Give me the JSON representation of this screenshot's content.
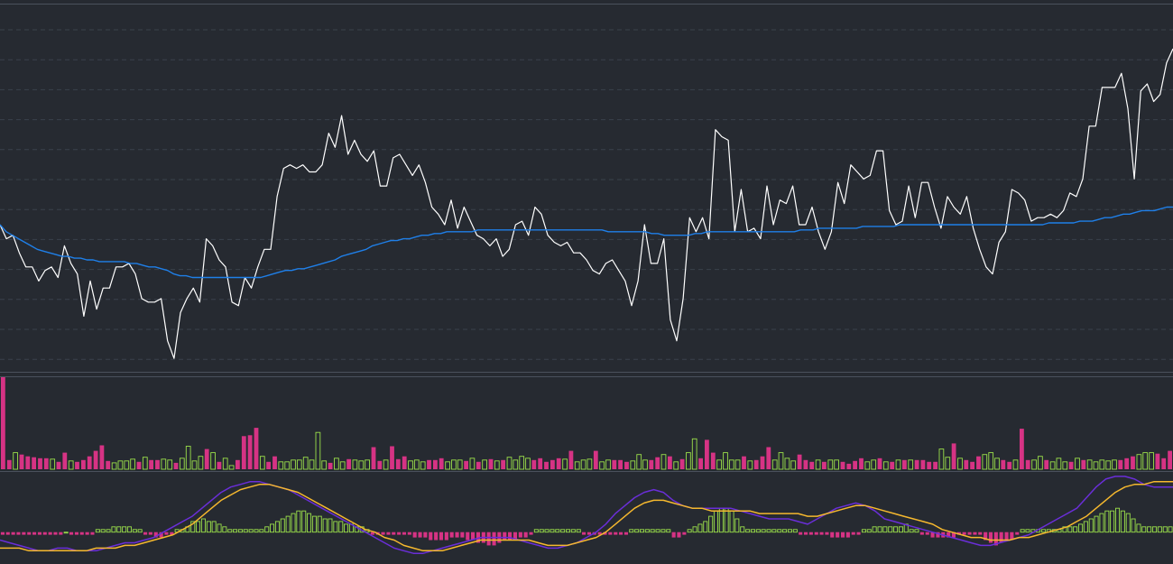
{
  "colors": {
    "background": "#262a31",
    "grid": "#3a414c",
    "separator": "#4a515c",
    "price_line": "#ffffff",
    "moving_average": "#1f7fe8",
    "volume_down": "#d63384",
    "volume_up": "#9be04a",
    "macd_line": "#6a2ed8",
    "signal_line": "#f5b82e"
  },
  "chart_data": [
    {
      "type": "line",
      "panel": "price",
      "grid": true,
      "xlabel": "",
      "ylabel": "",
      "ylim": [
        0,
        100
      ],
      "series": [
        {
          "role": "price",
          "values": [
            40,
            36,
            37,
            32,
            28,
            28,
            24,
            27,
            28,
            25,
            34,
            29,
            26,
            14,
            24,
            16,
            22,
            22,
            28,
            28,
            29,
            26,
            19,
            18,
            18,
            19,
            7,
            2,
            15,
            19,
            22,
            18,
            36,
            34,
            30,
            28,
            18,
            17,
            25,
            22,
            28,
            33,
            33,
            48,
            56,
            57,
            56,
            57,
            55,
            55,
            57,
            66,
            62,
            71,
            60,
            64,
            60,
            58,
            61,
            51,
            51,
            59,
            60,
            57,
            54,
            57,
            52,
            45,
            43,
            40,
            47,
            39,
            45,
            41,
            37,
            36,
            34,
            36,
            31,
            33,
            40,
            41,
            37,
            45,
            43,
            37,
            35,
            34,
            35,
            32,
            32,
            30,
            27,
            26,
            29,
            30,
            27,
            24,
            17,
            24,
            40,
            29,
            29,
            36,
            13,
            7,
            19,
            42,
            38,
            42,
            36,
            67,
            65,
            64,
            38,
            50,
            38,
            39,
            36,
            51,
            40,
            47,
            46,
            51,
            40,
            40,
            45,
            38,
            33,
            38,
            52,
            46,
            57,
            55,
            53,
            54,
            61,
            61,
            44,
            40,
            41,
            51,
            42,
            52,
            52,
            45,
            39,
            48,
            45,
            43,
            48,
            39,
            33,
            28,
            26,
            35,
            38,
            50,
            49,
            47,
            41,
            42,
            42,
            43,
            42,
            44,
            49,
            48,
            53,
            68,
            68,
            79,
            79,
            79,
            83,
            73,
            53,
            78,
            80,
            75,
            77,
            86,
            90
          ]
        },
        {
          "role": "moving_average",
          "values": [
            40,
            38,
            37,
            36,
            35,
            34,
            33,
            32.5,
            32,
            31.5,
            31,
            31,
            30.5,
            30.5,
            30,
            30,
            29.5,
            29.5,
            29.5,
            29.5,
            29.5,
            29,
            29,
            28.5,
            28,
            28,
            27.5,
            27,
            26,
            25.5,
            25.5,
            25,
            25,
            25,
            25,
            25,
            25,
            25,
            25,
            25,
            25,
            25,
            25,
            25.5,
            26,
            26.5,
            27,
            27,
            27.5,
            27.5,
            28,
            28.5,
            29,
            29.5,
            30,
            31,
            31.5,
            32,
            32.5,
            33,
            34,
            34.5,
            35,
            35.5,
            35.5,
            36,
            36,
            36.5,
            37,
            37,
            37.5,
            37.5,
            38,
            38,
            38,
            38,
            38,
            38.5,
            38.5,
            38.5,
            38.5,
            38.5,
            38.5,
            38.5,
            38.5,
            38.5,
            38.5,
            38.5,
            38.5,
            38.5,
            38.5,
            38.5,
            38.5,
            38.5,
            38.5,
            38.5,
            38.5,
            38.5,
            38,
            38,
            38,
            38,
            38,
            38,
            38,
            37.5,
            37.5,
            37,
            37,
            37,
            37,
            37,
            37.5,
            37.5,
            38,
            38,
            38,
            38,
            38,
            38,
            38,
            38,
            38,
            38,
            38,
            38,
            38,
            38,
            38,
            38.5,
            38.5,
            38.5,
            39,
            39,
            39,
            39,
            39,
            39,
            39,
            39.5,
            39.5,
            39.5,
            39.5,
            39.5,
            39.5,
            40,
            40,
            40,
            40,
            40,
            40,
            40,
            40,
            40,
            40,
            40,
            40,
            40,
            40,
            40,
            40,
            40,
            40,
            40,
            40,
            40,
            40,
            40,
            40,
            40.5,
            40.5,
            40.5,
            40.5,
            40.5,
            41,
            41,
            41,
            41.5,
            42,
            42,
            42.5,
            43,
            43,
            43.5,
            44,
            44,
            44,
            44.5,
            45,
            45
          ]
        }
      ]
    },
    {
      "type": "bar",
      "panel": "volume",
      "ylim": [
        0,
        100
      ],
      "values": [
        100,
        10,
        18,
        16,
        14,
        13,
        12,
        12,
        11,
        8,
        18,
        9,
        8,
        10,
        14,
        20,
        26,
        9,
        7,
        9,
        9,
        11,
        8,
        13,
        10,
        10,
        11,
        10,
        7,
        12,
        25,
        9,
        14,
        22,
        18,
        8,
        12,
        4,
        10,
        36,
        37,
        45,
        14,
        8,
        14,
        8,
        8,
        10,
        10,
        13,
        10,
        40,
        9,
        7,
        12,
        8,
        11,
        10,
        9,
        10,
        24,
        9,
        10,
        25,
        11,
        14,
        9,
        10,
        8,
        10,
        10,
        12,
        8,
        10,
        10,
        9,
        12,
        8,
        10,
        11,
        9,
        10,
        13,
        10,
        14,
        12,
        10,
        12,
        8,
        10,
        12,
        11,
        20,
        8,
        10,
        11,
        20,
        8,
        10,
        10,
        10,
        8,
        9,
        16,
        10,
        10,
        13,
        16,
        14,
        8,
        11,
        18,
        33,
        12,
        32,
        18,
        10,
        18,
        10,
        10,
        14,
        9,
        10,
        14,
        24,
        10,
        18,
        12,
        9,
        16,
        10,
        8,
        10,
        8,
        10,
        10,
        8,
        6,
        9,
        12,
        8,
        10,
        12,
        8,
        8,
        10,
        10,
        10,
        10,
        10,
        8,
        8,
        22,
        13,
        28,
        12,
        10,
        8,
        14,
        16,
        18,
        12,
        10,
        8,
        10,
        44,
        10,
        10,
        14,
        10,
        8,
        12,
        8,
        8,
        12,
        10,
        10,
        8,
        10,
        9,
        10,
        10,
        12,
        14,
        16,
        18,
        18,
        17,
        12,
        20
      ],
      "direction": [
        "down",
        "down",
        "up",
        "down",
        "down",
        "down",
        "down",
        "down",
        "up",
        "down",
        "down",
        "up",
        "down",
        "down",
        "down",
        "down",
        "down",
        "down",
        "up",
        "up",
        "up",
        "up",
        "down",
        "up",
        "down",
        "down",
        "up",
        "up",
        "down",
        "up",
        "up",
        "up",
        "up",
        "down",
        "up",
        "down",
        "up",
        "up",
        "down",
        "down",
        "down",
        "down",
        "up",
        "down",
        "down",
        "up",
        "up",
        "up",
        "up",
        "up",
        "up",
        "up",
        "up",
        "down",
        "up",
        "up",
        "down",
        "up",
        "up",
        "up",
        "down",
        "down",
        "up",
        "down",
        "down",
        "down",
        "up",
        "up",
        "up",
        "down",
        "down",
        "down",
        "up",
        "up",
        "up",
        "down",
        "up",
        "down",
        "up",
        "down",
        "up",
        "down",
        "up",
        "up",
        "up",
        "up",
        "down",
        "down",
        "down",
        "down",
        "down",
        "up",
        "down",
        "up",
        "up",
        "up",
        "down",
        "up",
        "up",
        "down",
        "down",
        "down",
        "up",
        "up",
        "up",
        "down",
        "down",
        "up",
        "down",
        "up",
        "down",
        "up",
        "up",
        "down",
        "down",
        "down",
        "up",
        "up",
        "up",
        "up",
        "down",
        "up",
        "down",
        "down",
        "down",
        "up",
        "up",
        "up",
        "up",
        "down",
        "down",
        "down",
        "up",
        "down",
        "up",
        "up",
        "down",
        "down",
        "down",
        "down",
        "up",
        "up",
        "down",
        "up",
        "down",
        "up",
        "down",
        "up",
        "down",
        "down",
        "down",
        "down",
        "up",
        "up",
        "down",
        "up",
        "down",
        "down",
        "down",
        "up",
        "up",
        "up",
        "down",
        "down",
        "up",
        "down",
        "down",
        "up",
        "up",
        "down",
        "up",
        "up",
        "up",
        "down",
        "up",
        "down",
        "up",
        "up",
        "up",
        "up",
        "up",
        "down",
        "down",
        "down",
        "up",
        "up",
        "up"
      ]
    },
    {
      "type": "bar",
      "panel": "macd",
      "ylim": [
        -12,
        22
      ],
      "series": [
        {
          "role": "histogram",
          "values": [
            -1,
            -1,
            -1,
            -1,
            -1,
            -1,
            -1,
            -1,
            -1,
            -1,
            -1,
            -1,
            0,
            -1,
            -1,
            -1,
            -1,
            -1,
            1,
            1,
            1,
            2,
            2,
            2,
            2,
            1,
            1,
            -1,
            -1,
            -2,
            -2,
            -1,
            -1,
            1,
            1,
            2,
            4,
            4,
            5,
            4,
            4,
            3,
            2,
            1,
            1,
            1,
            1,
            1,
            1,
            1,
            2,
            3,
            4,
            5,
            6,
            7,
            8,
            8,
            7,
            6,
            6,
            5,
            5,
            4,
            4,
            3,
            3,
            2,
            2,
            1,
            -1,
            -1,
            -1,
            -1,
            -1,
            -1,
            -1,
            -1,
            -2,
            -2,
            -2,
            -3,
            -3,
            -3,
            -3,
            -2,
            -2,
            -2,
            -3,
            -3,
            -4,
            -4,
            -5,
            -5,
            -4,
            -3,
            -3,
            -3,
            -2,
            -2,
            -1,
            1,
            1,
            1,
            1,
            1,
            1,
            1,
            1,
            1,
            -1,
            -1,
            -1,
            -1,
            -1,
            -1,
            -1,
            -1,
            -1,
            1,
            1,
            1,
            1,
            1,
            1,
            1,
            1,
            -2,
            -2,
            -1,
            1,
            2,
            3,
            4,
            6,
            8,
            9,
            9,
            8,
            5,
            2,
            1,
            1,
            1,
            1,
            1,
            1,
            1,
            1,
            1,
            1,
            -1,
            -1,
            -1,
            -1,
            -1,
            -1,
            -2,
            -2,
            -2,
            -2,
            -1,
            -1,
            1,
            1,
            2,
            2,
            2,
            2,
            2,
            2,
            3,
            1,
            1,
            -1,
            -1,
            -2,
            -2,
            -2,
            -2,
            -2,
            -1,
            -1,
            -1,
            -1,
            -1,
            -3,
            -4,
            -5,
            -4,
            -3,
            -3,
            -1,
            1,
            1,
            1,
            1,
            1,
            1,
            1,
            1,
            2,
            2,
            2,
            3,
            4,
            5,
            6,
            7,
            8,
            8,
            9,
            8,
            7,
            5,
            3,
            2,
            2,
            2,
            2,
            2,
            2
          ]
        },
        {
          "role": "macd_line",
          "values": [
            -3,
            -4,
            -5,
            -6,
            -7,
            -7,
            -6,
            -6,
            -7,
            -7,
            -7,
            -6,
            -5,
            -4,
            -4,
            -3,
            -2,
            0,
            2,
            4,
            6,
            9,
            12,
            15,
            17,
            18,
            19,
            19,
            18,
            17,
            16,
            14,
            12,
            10,
            8,
            6,
            4,
            2,
            0,
            -2,
            -4,
            -6,
            -7,
            -8,
            -8,
            -7,
            -6,
            -5,
            -4,
            -3,
            -2,
            -2,
            -2,
            -2,
            -3,
            -4,
            -5,
            -6,
            -6,
            -5,
            -4,
            -2,
            0,
            3,
            7,
            10,
            13,
            15,
            16,
            15,
            12,
            10,
            9,
            9,
            9,
            9,
            9,
            8,
            7,
            6,
            5,
            5,
            5,
            4,
            3,
            5,
            7,
            9,
            10,
            11,
            10,
            8,
            5,
            4,
            3,
            2,
            1,
            0,
            -1,
            -2,
            -3,
            -4,
            -5,
            -5,
            -4,
            -3,
            -2,
            -1,
            1,
            3,
            5,
            7,
            9,
            13,
            17,
            20,
            21,
            21,
            20,
            18,
            17,
            17,
            17
          ]
        },
        {
          "role": "signal_line",
          "values": [
            -6,
            -6,
            -6,
            -7,
            -7,
            -7,
            -7,
            -7,
            -7,
            -7,
            -6,
            -6,
            -6,
            -5,
            -5,
            -4,
            -3,
            -2,
            -1,
            1,
            3,
            6,
            9,
            12,
            14,
            16,
            17,
            18,
            18,
            17,
            16,
            15,
            13,
            11,
            9,
            7,
            5,
            3,
            1,
            0,
            -2,
            -3,
            -5,
            -6,
            -7,
            -7,
            -7,
            -6,
            -5,
            -4,
            -3,
            -3,
            -3,
            -3,
            -3,
            -3,
            -4,
            -5,
            -5,
            -5,
            -4,
            -3,
            -2,
            0,
            3,
            6,
            9,
            11,
            12,
            12,
            11,
            10,
            9,
            9,
            8,
            8,
            8,
            8,
            8,
            7,
            7,
            7,
            7,
            7,
            6,
            6,
            7,
            8,
            9,
            10,
            10,
            9,
            8,
            7,
            6,
            5,
            4,
            3,
            1,
            0,
            -1,
            -2,
            -2,
            -3,
            -3,
            -3,
            -2,
            -2,
            -1,
            0,
            1,
            2,
            4,
            6,
            9,
            12,
            15,
            17,
            18,
            18,
            19,
            19,
            19
          ]
        }
      ]
    }
  ]
}
